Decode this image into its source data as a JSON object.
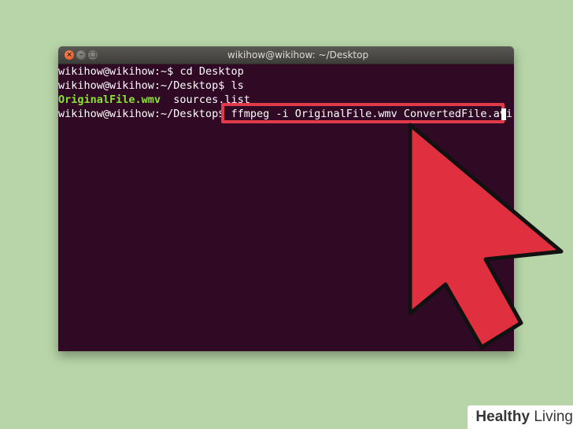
{
  "window": {
    "title": "wikihow@wikihow: ~/Desktop"
  },
  "terminal": {
    "lines": [
      {
        "prompt": "wikihow@wikihow:~$ ",
        "text": "cd Desktop"
      },
      {
        "prompt": "wikihow@wikihow:~/Desktop$ ",
        "text": "ls"
      },
      {
        "file1": "OriginalFile.wmv",
        "file2": "  sources.list"
      },
      {
        "prompt": "wikihow@wikihow:~/Desktop$ ",
        "command": "ffmpeg -i OriginalFile.wmv ConvertedFile.avi"
      }
    ]
  },
  "colors": {
    "terminal_bg": "#300a24",
    "highlight": "#e03a4b",
    "arrow": "#e0303f",
    "background": "#b7d5a8",
    "file_green": "#8ae234"
  },
  "watermark": {
    "word1": "Healthy",
    "word2": "Living"
  }
}
